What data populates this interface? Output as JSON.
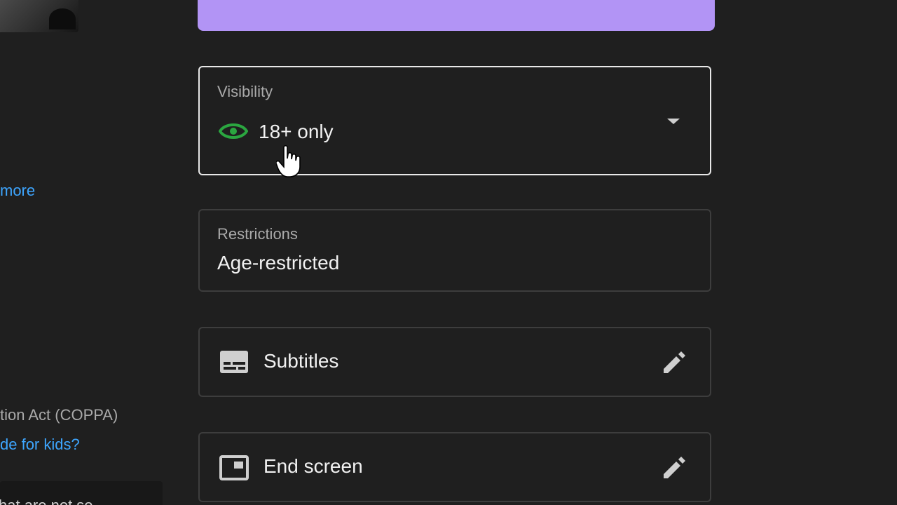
{
  "left_column": {
    "show_more_link": "more",
    "coppa_text": "tion Act (COPPA)",
    "kids_link": "de for kids?",
    "bottom_text": "hat are not so"
  },
  "visibility": {
    "label": "Visibility",
    "value": "18+ only",
    "icon": "eye-icon",
    "icon_color": "#2ba640"
  },
  "restrictions": {
    "label": "Restrictions",
    "value": "Age-restricted"
  },
  "subtitles": {
    "label": "Subtitles",
    "icon": "subtitles-icon"
  },
  "end_screen": {
    "label": "End screen",
    "icon": "end-screen-icon"
  },
  "colors": {
    "accent_purple": "#b294f5",
    "link_blue": "#3ea6ff",
    "background": "#1f1f1f"
  }
}
